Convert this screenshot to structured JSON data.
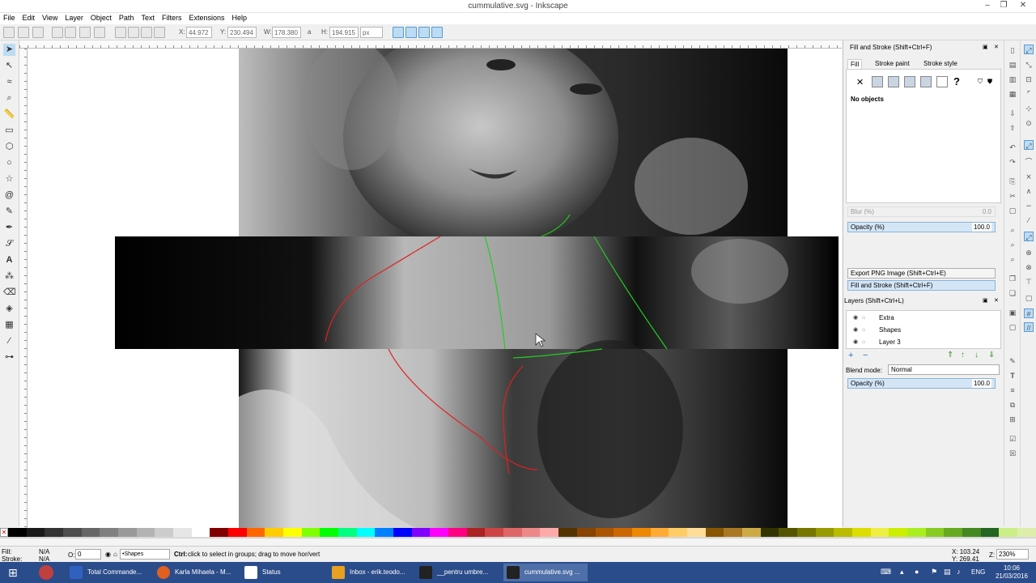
{
  "window": {
    "title": "cummulative.svg - Inkscape"
  },
  "menu": [
    "File",
    "Edit",
    "View",
    "Layer",
    "Object",
    "Path",
    "Text",
    "Filters",
    "Extensions",
    "Help"
  ],
  "toolbar": {
    "x_label": "X:",
    "x_value": "44.972",
    "y_label": "Y:",
    "y_value": "230.494",
    "w_label": "W:",
    "w_value": "178.380",
    "h_label": "H:",
    "h_value": "194.915",
    "unit": "px"
  },
  "fill_stroke": {
    "title": "Fill and Stroke (Shift+Ctrl+F)",
    "tab_fill": "Fill",
    "tab_stroke_paint": "Stroke paint",
    "tab_stroke_style": "Stroke style",
    "no_objects": "No objects",
    "unset_glyph": "?",
    "blur_label": "Blur (%)",
    "blur_value": "0.0",
    "opacity_label": "Opacity (%)",
    "opacity_value": "100.0"
  },
  "docked": {
    "export_png": "Export PNG Image (Shift+Ctrl+E)",
    "fill_stroke": "Fill and Stroke (Shift+Ctrl+F)"
  },
  "layers": {
    "title": "Layers (Shift+Ctrl+L)",
    "items": [
      {
        "name": "Extra"
      },
      {
        "name": "Shapes"
      },
      {
        "name": "Layer 3"
      }
    ],
    "blend_label": "Blend mode:",
    "blend_value": "Normal",
    "opacity_label": "Opacity (%)",
    "opacity_value": "100.0"
  },
  "status": {
    "fill_label": "Fill:",
    "fill_value": "N/A",
    "stroke_label": "Stroke:",
    "stroke_value": "N/A",
    "o_label": "O:",
    "o_value": "0",
    "layer_name": "•Shapes",
    "hint_key": "Ctrl:",
    "hint_text": "click to select in groups; drag to move hor/vert",
    "x_readout": "X: 103.24",
    "y_readout": "Y: 269.41",
    "zoom_label": "Z:",
    "zoom_value": "230%"
  },
  "taskbar": {
    "items": [
      {
        "label": "Total Commande..."
      },
      {
        "label": "Karla Mihaela - M..."
      },
      {
        "label": "Status"
      },
      {
        "label": "Inbox - erik.teodo..."
      },
      {
        "label": "__pentru umbre..."
      },
      {
        "label": "cummulative.svg ..."
      }
    ],
    "lang": "ENG",
    "time": "10:06",
    "date": "21/03/2016"
  },
  "palette_colors": [
    "#000000",
    "#1a1a1a",
    "#333333",
    "#4d4d4d",
    "#666666",
    "#808080",
    "#999999",
    "#b3b3b3",
    "#cccccc",
    "#e6e6e6",
    "#ffffff",
    "#800000",
    "#ff0000",
    "#ff6600",
    "#ffcc00",
    "#ffff00",
    "#80ff00",
    "#00ff00",
    "#00ff80",
    "#00ffff",
    "#0080ff",
    "#0000ff",
    "#8000ff",
    "#ff00ff",
    "#ff0080",
    "#aa2222",
    "#cc4444",
    "#dd6666",
    "#ee8888",
    "#ffaaaa",
    "#553300",
    "#884400",
    "#aa5500",
    "#cc6600",
    "#ee8800",
    "#ffaa33",
    "#ffcc66",
    "#ffdd99",
    "#885500",
    "#aa7722",
    "#ccaa44",
    "#333300",
    "#555500",
    "#777700",
    "#999900",
    "#bbbb00",
    "#dddd00",
    "#eeee44",
    "#ccee00",
    "#aaee22",
    "#88cc22",
    "#66aa22",
    "#448822",
    "#226622",
    "#ccee88",
    "#ddeeaa"
  ]
}
